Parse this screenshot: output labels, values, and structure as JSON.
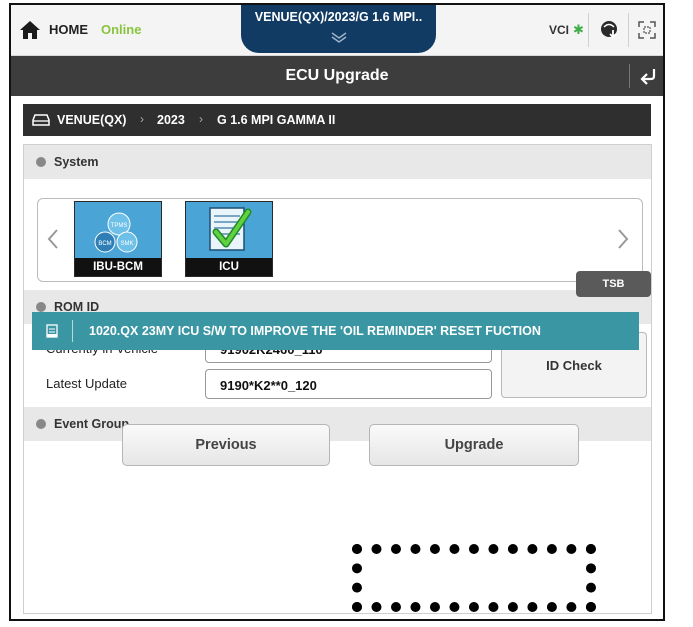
{
  "topbar": {
    "home_label": "HOME",
    "status": "Online",
    "vehicle_tab": "VENUE(QX)/2023/G 1.6 MPI..",
    "vci_label": "VCI",
    "bt_symbol": "✱",
    "accent_colors": {
      "online": "#8ac43f",
      "tab": "#123b63",
      "bluetooth": "#3fae49"
    }
  },
  "title": "ECU Upgrade",
  "breadcrumb": {
    "model": "VENUE(QX)",
    "year": "2023",
    "engine": "G 1.6 MPI GAMMA II",
    "separator": "›"
  },
  "system": {
    "header": "System",
    "ecus": [
      {
        "label": "IBU-BCM",
        "badges": [
          "TPMS",
          "BCM",
          "SMK"
        ]
      },
      {
        "label": "ICU",
        "selected": true
      }
    ]
  },
  "rom_id": {
    "header": "ROM ID",
    "current_label": "Currently in Vehicle",
    "current_value": "91902K2460_110",
    "latest_label": "Latest Update",
    "latest_value": "9190*K2**0_120",
    "id_check_label": "ID Check"
  },
  "event_group": {
    "header": "Event Group",
    "tsb_label": "TSB",
    "events": [
      {
        "text": "1020.QX 23MY ICU S/W TO IMPROVE THE 'OIL REMINDER' RESET FUCTION",
        "color": "#3b96a4"
      }
    ]
  },
  "actions": {
    "previous_label": "Previous",
    "upgrade_label": "Upgrade"
  }
}
